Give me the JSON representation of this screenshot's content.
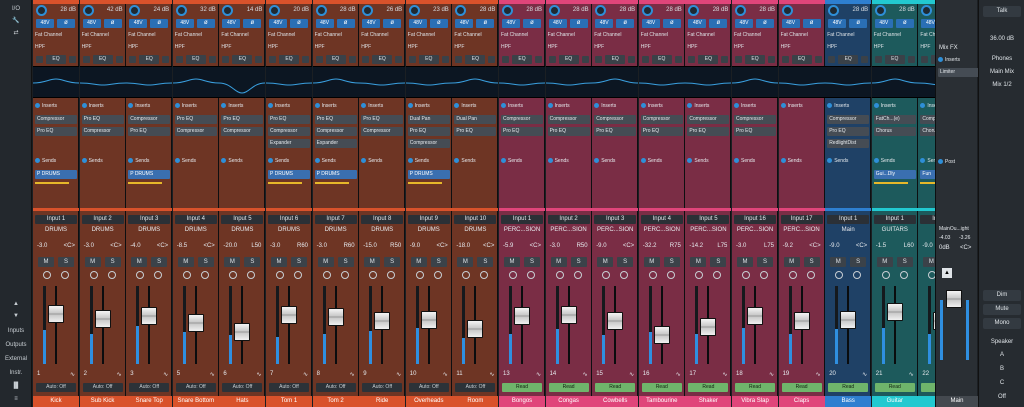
{
  "left_panel": {
    "io_label": "I/O",
    "inputs_label": "Inputs",
    "outputs_label": "Outputs",
    "external_label": "External",
    "instr_label": "Instr."
  },
  "labels": {
    "phantom": "48V",
    "phase": "ø",
    "fat_channel": "Fat Channel",
    "hpf": "HPF",
    "eq": "EQ",
    "inserts": "Inserts",
    "sends": "Sends",
    "mute": "M",
    "solo": "S",
    "center": "<C>"
  },
  "channels": [
    {
      "num": "1",
      "name": "Kick",
      "gain": "28 dB",
      "input": "Input 1",
      "group": "DRUMS",
      "vol": "-3.0",
      "pan": "<C>",
      "level": "-3.0",
      "auto": "Auto: Off",
      "color": "#d9522b",
      "body": "#6e3524",
      "inserts": [
        "Compressor",
        "Pro EQ"
      ],
      "sends": [
        "P DRUMS"
      ],
      "fader": 0.7,
      "meter": 0.45
    },
    {
      "num": "2",
      "name": "Sub Kick",
      "gain": "42 dB",
      "input": "Input 2",
      "group": "DRUMS",
      "vol": "-3.0",
      "pan": "<C>",
      "level": "-3.0",
      "auto": "Auto: Off",
      "color": "#d9522b",
      "body": "#6e3524",
      "inserts": [
        "Pro EQ",
        "Compressor"
      ],
      "sends": [],
      "fader": 0.62,
      "meter": 0.4
    },
    {
      "num": "3",
      "name": "Snare Top",
      "gain": "24 dB",
      "input": "Input 3",
      "group": "DRUMS",
      "vol": "-4.0",
      "pan": "<C>",
      "level": "-4.0",
      "auto": "Auto: Off",
      "color": "#d9522b",
      "body": "#6e3524",
      "inserts": [
        "Compressor",
        "Pro EQ"
      ],
      "sends": [
        "P DRUMS"
      ],
      "fader": 0.66,
      "meter": 0.5
    },
    {
      "num": "5",
      "name": "Snare Bottom",
      "gain": "32 dB",
      "input": "Input 4",
      "group": "DRUMS",
      "vol": "-8.5",
      "pan": "<C>",
      "level": "-8.5",
      "auto": "Auto: Off",
      "color": "#d9522b",
      "body": "#6e3524",
      "inserts": [
        "Pro EQ",
        "Compressor"
      ],
      "sends": [],
      "fader": 0.55,
      "meter": 0.42
    },
    {
      "num": "6",
      "name": "Hats",
      "gain": "14 dB",
      "input": "Input 5",
      "group": "DRUMS",
      "vol": "-20.0",
      "pan": "L50",
      "level": "-20.0",
      "auto": "Auto: Off",
      "color": "#d9522b",
      "body": "#6e3524",
      "inserts": [
        "Pro EQ",
        "Compressor"
      ],
      "sends": [],
      "fader": 0.4,
      "meter": 0.38
    },
    {
      "num": "7",
      "name": "Tom 1",
      "gain": "20 dB",
      "input": "Input 6",
      "group": "DRUMS",
      "vol": "-3.0",
      "pan": "R60",
      "level": "-3.0",
      "auto": "Auto: Off",
      "color": "#d9522b",
      "body": "#6e3524",
      "inserts": [
        "Pro EQ",
        "Compressor",
        "Expander"
      ],
      "sends": [
        "P DRUMS"
      ],
      "fader": 0.68,
      "meter": 0.36
    },
    {
      "num": "8",
      "name": "Tom 2",
      "gain": "28 dB",
      "input": "Input 7",
      "group": "DRUMS",
      "vol": "-3.0",
      "pan": "R60",
      "level": "-3.0",
      "auto": "Auto: Off",
      "color": "#d9522b",
      "body": "#6e3524",
      "inserts": [
        "Pro EQ",
        "Compressor",
        "Expander"
      ],
      "sends": [
        "P DRUMS"
      ],
      "fader": 0.64,
      "meter": 0.4
    },
    {
      "num": "9",
      "name": "Ride",
      "gain": "26 dB",
      "input": "Input 8",
      "group": "DRUMS",
      "vol": "-15.0",
      "pan": "R50",
      "level": "-15.0",
      "auto": "Auto: Off",
      "color": "#d9522b",
      "body": "#6e3524",
      "inserts": [
        "Pro EQ",
        "Compressor"
      ],
      "sends": [],
      "fader": 0.58,
      "meter": 0.44
    },
    {
      "num": "10",
      "name": "Overheads",
      "gain": "23 dB",
      "input": "Input 9",
      "group": "DRUMS",
      "vol": "-9.0",
      "pan": "<C>",
      "level": "-9.0",
      "auto": "Auto: Off",
      "color": "#d9522b",
      "body": "#6e3524",
      "inserts": [
        "Dual Pan",
        "Pro EQ",
        "Compressor"
      ],
      "sends": [
        "P DRUMS"
      ],
      "fader": 0.6,
      "meter": 0.48
    },
    {
      "num": "11",
      "name": "Room",
      "gain": "28 dB",
      "input": "Input 10",
      "group": "DRUMS",
      "vol": "-18.0",
      "pan": "<C>",
      "level": "-18.0",
      "auto": "Auto: Off",
      "color": "#d9522b",
      "body": "#6e3524",
      "inserts": [
        "Dual Pan",
        "Pro EQ"
      ],
      "sends": [],
      "fader": 0.45,
      "meter": 0.34
    },
    {
      "num": "13",
      "name": "Bongos",
      "gain": "28 dB",
      "input": "Input 1",
      "group": "PERC...SION",
      "vol": "-5.9",
      "pan": "<C>",
      "level": "-5.9",
      "auto": "Read",
      "color": "#e0457a",
      "body": "#7a2d45",
      "inserts": [
        "Compressor",
        "Pro EQ"
      ],
      "sends": [],
      "fader": 0.66,
      "meter": 0.4
    },
    {
      "num": "14",
      "name": "Congas",
      "gain": "28 dB",
      "input": "Input 2",
      "group": "PERC...SION",
      "vol": "-3.0",
      "pan": "R50",
      "level": "-3.0",
      "auto": "Read",
      "color": "#e0457a",
      "body": "#7a2d45",
      "inserts": [
        "Compressor",
        "Pro EQ"
      ],
      "sends": [],
      "fader": 0.68,
      "meter": 0.46
    },
    {
      "num": "15",
      "name": "Cowbells",
      "gain": "28 dB",
      "input": "Input 3",
      "group": "PERC...SION",
      "vol": "-9.0",
      "pan": "<C>",
      "level": "-9.0",
      "auto": "Read",
      "color": "#e0457a",
      "body": "#7a2d45",
      "inserts": [
        "Compressor",
        "Pro EQ"
      ],
      "sends": [],
      "fader": 0.58,
      "meter": 0.38
    },
    {
      "num": "16",
      "name": "Tambourine",
      "gain": "28 dB",
      "input": "Input 4",
      "group": "PERC...SION",
      "vol": "-32.2",
      "pan": "R75",
      "level": "-32.2",
      "auto": "Read",
      "color": "#e0457a",
      "body": "#7a2d45",
      "inserts": [
        "Compressor",
        "Pro EQ"
      ],
      "sends": [],
      "fader": 0.36,
      "meter": 0.42
    },
    {
      "num": "17",
      "name": "Shaker",
      "gain": "28 dB",
      "input": "Input 5",
      "group": "PERC...SION",
      "vol": "-14.2",
      "pan": "L75",
      "level": "-14.2",
      "auto": "Read",
      "color": "#e0457a",
      "body": "#7a2d45",
      "inserts": [
        "Compressor",
        "Pro EQ"
      ],
      "sends": [],
      "fader": 0.48,
      "meter": 0.4
    },
    {
      "num": "18",
      "name": "Vibra Slap",
      "gain": "28 dB",
      "input": "Input 16",
      "group": "PERC...SION",
      "vol": "-3.0",
      "pan": "L75",
      "level": "-3.0",
      "auto": "Read",
      "color": "#e0457a",
      "body": "#7a2d45",
      "inserts": [
        "Compressor",
        "Pro EQ"
      ],
      "sends": [],
      "fader": 0.66,
      "meter": 0.48
    },
    {
      "num": "19",
      "name": "Claps",
      "gain": "",
      "input": "Input 17",
      "group": "PERC...SION",
      "vol": "-9.2",
      "pan": "<C>",
      "level": "-9.2",
      "auto": "Read",
      "color": "#e0457a",
      "body": "#7a2d45",
      "inserts": [],
      "sends": [],
      "fader": 0.58,
      "meter": 0.4
    },
    {
      "num": "20",
      "name": "Bass",
      "gain": "28 dB",
      "input": "Input 1",
      "group": "Main",
      "vol": "-9.0",
      "pan": "<C>",
      "level": "-9.0",
      "auto": "Read",
      "color": "#2e7fd0",
      "body": "#1f4166",
      "inserts": [
        "Compressor",
        "Pro EQ",
        "RedlightDist"
      ],
      "sends": [],
      "fader": 0.6,
      "meter": 0.46
    },
    {
      "num": "21",
      "name": "Guitar",
      "gain": "28 dB",
      "input": "Input 1",
      "group": "GUITARS",
      "vol": "-1.5",
      "pan": "L60",
      "level": "-1.5",
      "auto": "Read",
      "color": "#22c9d0",
      "body": "#1d5a5c",
      "inserts": [
        "FatCh...(e)",
        "Chorus"
      ],
      "sends": [
        "Gui...Dly"
      ],
      "fader": 0.72,
      "meter": 0.48
    },
    {
      "num": "22",
      "name": "Fun",
      "gain": "28 dB",
      "input": "Input 1",
      "group": "GU",
      "vol": "-9.0",
      "pan": "",
      "level": "-9.0",
      "auto": "Read",
      "color": "#22c9d0",
      "body": "#1d5a5c",
      "inserts": [
        "Compressor",
        "Chorus"
      ],
      "sends": [
        "Fun"
      ],
      "fader": 0.58,
      "meter": 0.4
    }
  ],
  "mixfx": {
    "title": "Mix FX",
    "inserts_label": "Inserts",
    "insert": "Limiter",
    "post_label": "Post"
  },
  "main": {
    "name": "Main",
    "route": "MainOu...ight",
    "lvl_l": "-4.03",
    "lvl_r": "-3.26",
    "vol": "0dB",
    "pan": "<C>"
  },
  "right_panel": {
    "talk": "Talk",
    "talk_level": "36.00 dB",
    "phones": "Phones",
    "main_mix": "Main Mix",
    "mix12": "Mix 1/2",
    "dim": "Dim",
    "mute": "Mute",
    "mono": "Mono",
    "speaker": "Speaker",
    "spk_a": "A",
    "spk_b": "B",
    "spk_c": "C",
    "off": "Off"
  }
}
